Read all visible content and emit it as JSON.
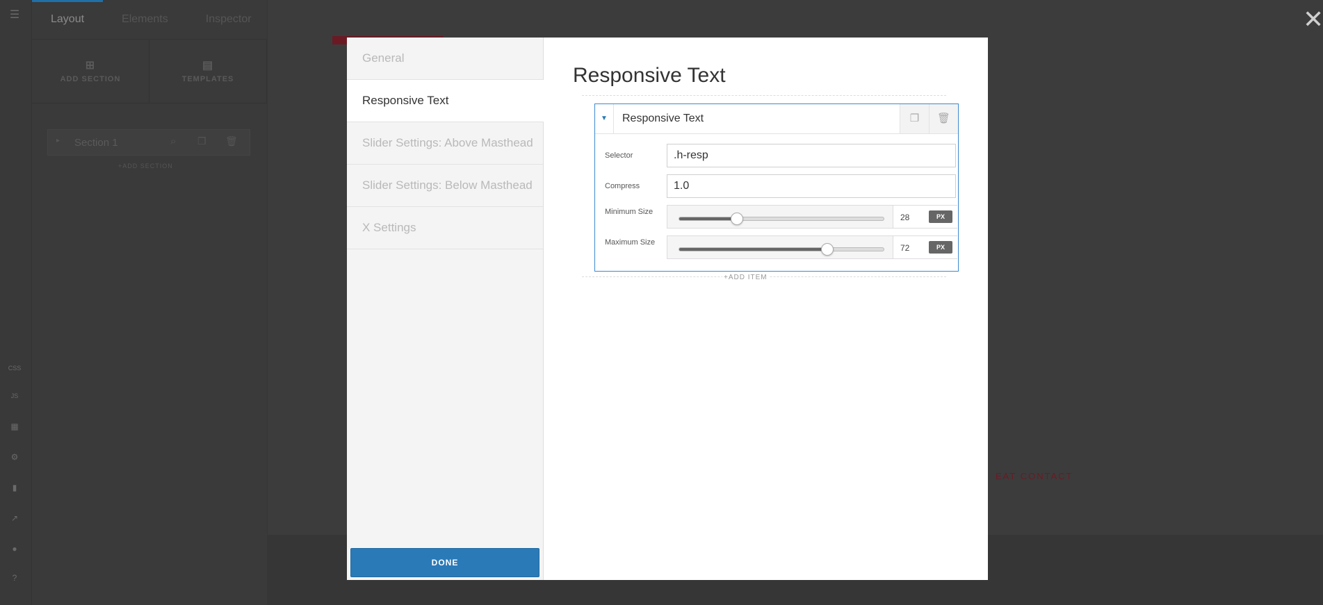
{
  "builder": {
    "tabs": [
      {
        "label": "Layout"
      },
      {
        "label": "Elements"
      },
      {
        "label": "Inspector"
      }
    ],
    "actions": {
      "add_section": "ADD SECTION",
      "templates": "TEMPLATES"
    },
    "section": {
      "name": "Section 1",
      "add_section_label": "+ADD SECTION"
    },
    "rail": [
      "menu-icon",
      "css",
      "js",
      "settings"
    ],
    "rail_labels": {
      "css": "CSS",
      "js": "JS"
    },
    "canvas_nav_text": "EAT CONTACT"
  },
  "modal": {
    "nav": [
      {
        "label": "General"
      },
      {
        "label": "Responsive Text"
      },
      {
        "label": "Slider Settings: Above Masthead"
      },
      {
        "label": "Slider Settings: Below Masthead"
      },
      {
        "label": "X Settings"
      }
    ],
    "active_nav_index": 1,
    "done_label": "DONE",
    "title": "Responsive Text",
    "card": {
      "title": "Responsive Text",
      "fields": {
        "selector": {
          "label": "Selector",
          "value": ".h-resp"
        },
        "compress": {
          "label": "Compress",
          "value": "1.0"
        },
        "min_size": {
          "label": "Minimum Size",
          "value": "28",
          "unit": "PX",
          "fraction": 0.28
        },
        "max_size": {
          "label": "Maximum Size",
          "value": "72",
          "unit": "PX",
          "fraction": 0.72
        }
      }
    },
    "add_item_label": "+ADD ITEM"
  },
  "colors": {
    "accent": "#2a7ab8",
    "card_border": "#3a8ad0",
    "canvas_brand": "#6b1a24"
  }
}
